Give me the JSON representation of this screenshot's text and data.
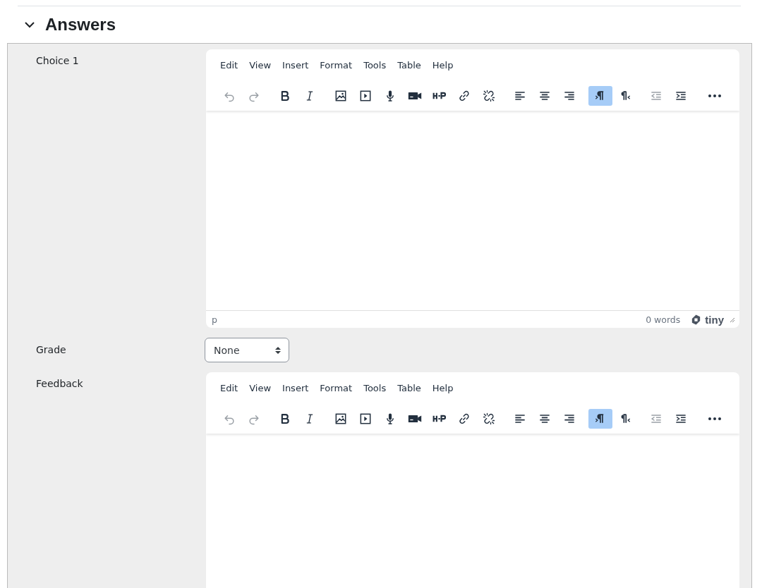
{
  "section": {
    "title": "Answers",
    "expanded": true
  },
  "fields": [
    {
      "kind": "editor",
      "label": "Choice 1",
      "menu": [
        "Edit",
        "View",
        "Insert",
        "Format",
        "Tools",
        "Table",
        "Help"
      ],
      "toolbar": [
        [
          {
            "kind": "undo",
            "disabled": true,
            "on": false
          },
          {
            "kind": "redo",
            "disabled": true,
            "on": false
          }
        ],
        [
          {
            "kind": "bold",
            "disabled": false,
            "on": false
          },
          {
            "kind": "italic",
            "disabled": false,
            "on": false
          }
        ],
        [
          {
            "kind": "image",
            "disabled": false,
            "on": false
          },
          {
            "kind": "media",
            "disabled": false,
            "on": false
          },
          {
            "kind": "audio",
            "disabled": false,
            "on": false
          },
          {
            "kind": "video",
            "disabled": false,
            "on": false
          },
          {
            "kind": "h5p",
            "disabled": false,
            "on": false
          },
          {
            "kind": "link",
            "disabled": false,
            "on": false
          },
          {
            "kind": "unlink",
            "disabled": false,
            "on": false
          }
        ],
        [
          {
            "kind": "align-left",
            "disabled": false,
            "on": false
          },
          {
            "kind": "align-center",
            "disabled": false,
            "on": false
          },
          {
            "kind": "align-right",
            "disabled": false,
            "on": false
          }
        ],
        [
          {
            "kind": "ltr",
            "disabled": false,
            "on": true
          },
          {
            "kind": "rtl",
            "disabled": false,
            "on": false
          }
        ],
        [
          {
            "kind": "outdent",
            "disabled": true,
            "on": false
          },
          {
            "kind": "indent",
            "disabled": false,
            "on": false
          }
        ],
        [
          {
            "kind": "more",
            "disabled": false,
            "on": false
          }
        ]
      ],
      "status": {
        "path": "p",
        "words": "0 words",
        "brand": "tiny"
      }
    },
    {
      "kind": "select",
      "label": "Grade",
      "value": "None"
    },
    {
      "kind": "editor",
      "label": "Feedback",
      "menu": [
        "Edit",
        "View",
        "Insert",
        "Format",
        "Tools",
        "Table",
        "Help"
      ],
      "toolbar": [
        [
          {
            "kind": "undo",
            "disabled": true,
            "on": false
          },
          {
            "kind": "redo",
            "disabled": true,
            "on": false
          }
        ],
        [
          {
            "kind": "bold",
            "disabled": false,
            "on": false
          },
          {
            "kind": "italic",
            "disabled": false,
            "on": false
          }
        ],
        [
          {
            "kind": "image",
            "disabled": false,
            "on": false
          },
          {
            "kind": "media",
            "disabled": false,
            "on": false
          },
          {
            "kind": "audio",
            "disabled": false,
            "on": false
          },
          {
            "kind": "video",
            "disabled": false,
            "on": false
          },
          {
            "kind": "h5p",
            "disabled": false,
            "on": false
          },
          {
            "kind": "link",
            "disabled": false,
            "on": false
          },
          {
            "kind": "unlink",
            "disabled": false,
            "on": false
          }
        ],
        [
          {
            "kind": "align-left",
            "disabled": false,
            "on": false
          },
          {
            "kind": "align-center",
            "disabled": false,
            "on": false
          },
          {
            "kind": "align-right",
            "disabled": false,
            "on": false
          }
        ],
        [
          {
            "kind": "ltr",
            "disabled": false,
            "on": true
          },
          {
            "kind": "rtl",
            "disabled": false,
            "on": false
          }
        ],
        [
          {
            "kind": "outdent",
            "disabled": true,
            "on": false
          },
          {
            "kind": "indent",
            "disabled": false,
            "on": false
          }
        ],
        [
          {
            "kind": "more",
            "disabled": false,
            "on": false
          }
        ]
      ]
    }
  ]
}
